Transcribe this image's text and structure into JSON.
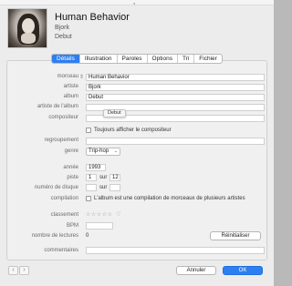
{
  "header": {
    "title": "Human Behavior",
    "artist": "Bjork",
    "album": "Debut"
  },
  "tabs": [
    {
      "label": "Détails",
      "active": true
    },
    {
      "label": "Illustration",
      "active": false
    },
    {
      "label": "Paroles",
      "active": false
    },
    {
      "label": "Options",
      "active": false
    },
    {
      "label": "Tri",
      "active": false
    },
    {
      "label": "Fichier",
      "active": false
    }
  ],
  "form": {
    "morceau_label": "morceau",
    "morceau_value": "Human Behavior",
    "artiste_label": "artiste",
    "artiste_value": "Bjork",
    "album_label": "album",
    "album_value": "Debut",
    "album_artist_label": "artiste de l'album",
    "album_artist_value": "",
    "compositeur_label": "compositeur",
    "compositeur_value": "",
    "tooltip": "Debut",
    "show_composer_label": "Toujours afficher le compositeur",
    "regroupement_label": "regroupement",
    "regroupement_value": "",
    "genre_label": "genre",
    "genre_value": "Trip-hop",
    "annee_label": "année",
    "annee_value": "1993",
    "piste_label": "piste",
    "piste_value": "1",
    "sur_label": "sur",
    "piste_total": "12",
    "disque_label": "numéro de disque",
    "disque_value": "",
    "disque_total": "",
    "compilation_label": "compilation",
    "compilation_text": "L'album est une compilation de morceaux de plusieurs artistes",
    "classement_label": "classement",
    "bpm_label": "BPM",
    "bpm_value": "",
    "lectures_label": "nombre de lectures",
    "lectures_value": "0",
    "reset_label": "Réinitialiser",
    "commentaires_label": "commentaires",
    "commentaires_value": ""
  },
  "footer": {
    "cancel_label": "Annuler",
    "ok_label": "OK"
  },
  "colors": {
    "accent": "#2d7ff0"
  }
}
